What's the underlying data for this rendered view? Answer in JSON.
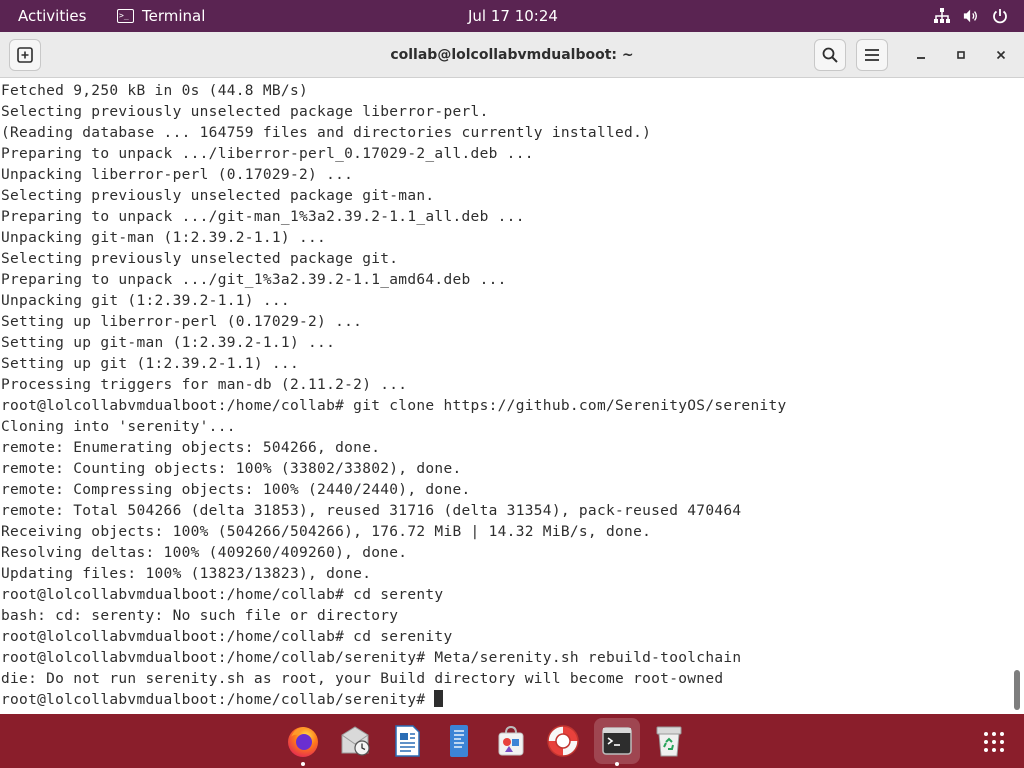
{
  "topbar": {
    "activities": "Activities",
    "app_name": "Terminal",
    "clock": "Jul 17  10:24",
    "tray_icons": [
      "network-icon",
      "volume-icon",
      "power-icon"
    ]
  },
  "window": {
    "title": "collab@lolcollabvmdualboot: ~"
  },
  "terminal": {
    "lines": [
      "Fetched 9,250 kB in 0s (44.8 MB/s)",
      "Selecting previously unselected package liberror-perl.",
      "(Reading database ... 164759 files and directories currently installed.)",
      "Preparing to unpack .../liberror-perl_0.17029-2_all.deb ...",
      "Unpacking liberror-perl (0.17029-2) ...",
      "Selecting previously unselected package git-man.",
      "Preparing to unpack .../git-man_1%3a2.39.2-1.1_all.deb ...",
      "Unpacking git-man (1:2.39.2-1.1) ...",
      "Selecting previously unselected package git.",
      "Preparing to unpack .../git_1%3a2.39.2-1.1_amd64.deb ...",
      "Unpacking git (1:2.39.2-1.1) ...",
      "Setting up liberror-perl (0.17029-2) ...",
      "Setting up git-man (1:2.39.2-1.1) ...",
      "Setting up git (1:2.39.2-1.1) ...",
      "Processing triggers for man-db (2.11.2-2) ...",
      "root@lolcollabvmdualboot:/home/collab# git clone https://github.com/SerenityOS/serenity",
      "Cloning into 'serenity'...",
      "remote: Enumerating objects: 504266, done.",
      "remote: Counting objects: 100% (33802/33802), done.",
      "remote: Compressing objects: 100% (2440/2440), done.",
      "remote: Total 504266 (delta 31853), reused 31716 (delta 31354), pack-reused 470464",
      "Receiving objects: 100% (504266/504266), 176.72 MiB | 14.32 MiB/s, done.",
      "Resolving deltas: 100% (409260/409260), done.",
      "Updating files: 100% (13823/13823), done.",
      "root@lolcollabvmdualboot:/home/collab# cd serenty",
      "bash: cd: serenty: No such file or directory",
      "root@lolcollabvmdualboot:/home/collab# cd serenity",
      "root@lolcollabvmdualboot:/home/collab/serenity# Meta/serenity.sh rebuild-toolchain",
      "die: Do not run serenity.sh as root, your Build directory will become root-owned"
    ],
    "prompt": "root@lolcollabvmdualboot:/home/collab/serenity# ",
    "text_color": "#2e2e2e",
    "background": "#ffffff"
  },
  "dock": {
    "apps": [
      {
        "name": "firefox-icon",
        "running": true
      },
      {
        "name": "mail-calendar-icon",
        "running": false
      },
      {
        "name": "writer-document-icon",
        "running": false
      },
      {
        "name": "text-editor-icon",
        "running": false
      },
      {
        "name": "software-store-icon",
        "running": false
      },
      {
        "name": "help-lifebuoy-icon",
        "running": false
      },
      {
        "name": "terminal-icon",
        "running": true,
        "active": true
      },
      {
        "name": "trash-icon",
        "running": false
      }
    ],
    "background": "#8a1e2b"
  },
  "colors": {
    "topbar": "#5a2452",
    "headerbar": "#ebebeb"
  }
}
